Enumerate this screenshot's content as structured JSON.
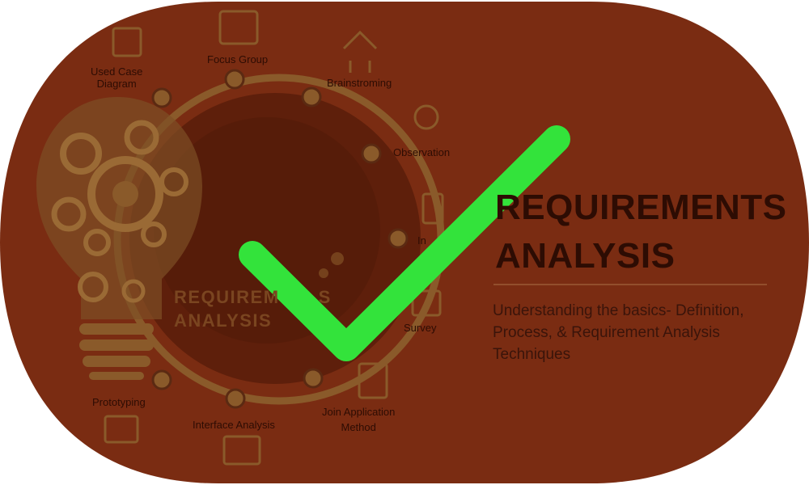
{
  "poster": {
    "title_line1": "REQUIREMENTS",
    "title_line2": "ANALYSIS",
    "subtitle": "Understanding the basics- Definition, Process, & Requirement Analysis Techniques",
    "bulb_label_line1": "REQUIREM",
    "bulb_label_suffix": "S",
    "bulb_label_line2": "ANALYSIS"
  },
  "techniques": [
    {
      "label_line1": "Used Case",
      "label_line2": "Diagram"
    },
    {
      "label_line1": "Focus Group"
    },
    {
      "label_line1": "Brainstroming"
    },
    {
      "label_line1": "Observation"
    },
    {
      "label_line1": "In"
    },
    {
      "label_line1": "Survey"
    },
    {
      "label_line1": "Join Application",
      "label_line2": "Method"
    },
    {
      "label_line1": "Interface Analysis"
    },
    {
      "label_line1": "Prototyping"
    }
  ],
  "overlay": {
    "icon": "checkmark-icon",
    "color": "#33e33b"
  },
  "colors": {
    "background": "#ffffff",
    "card": "#7a2c12",
    "accent_ring": "#8a5a2a",
    "text": "#2d0c03"
  }
}
